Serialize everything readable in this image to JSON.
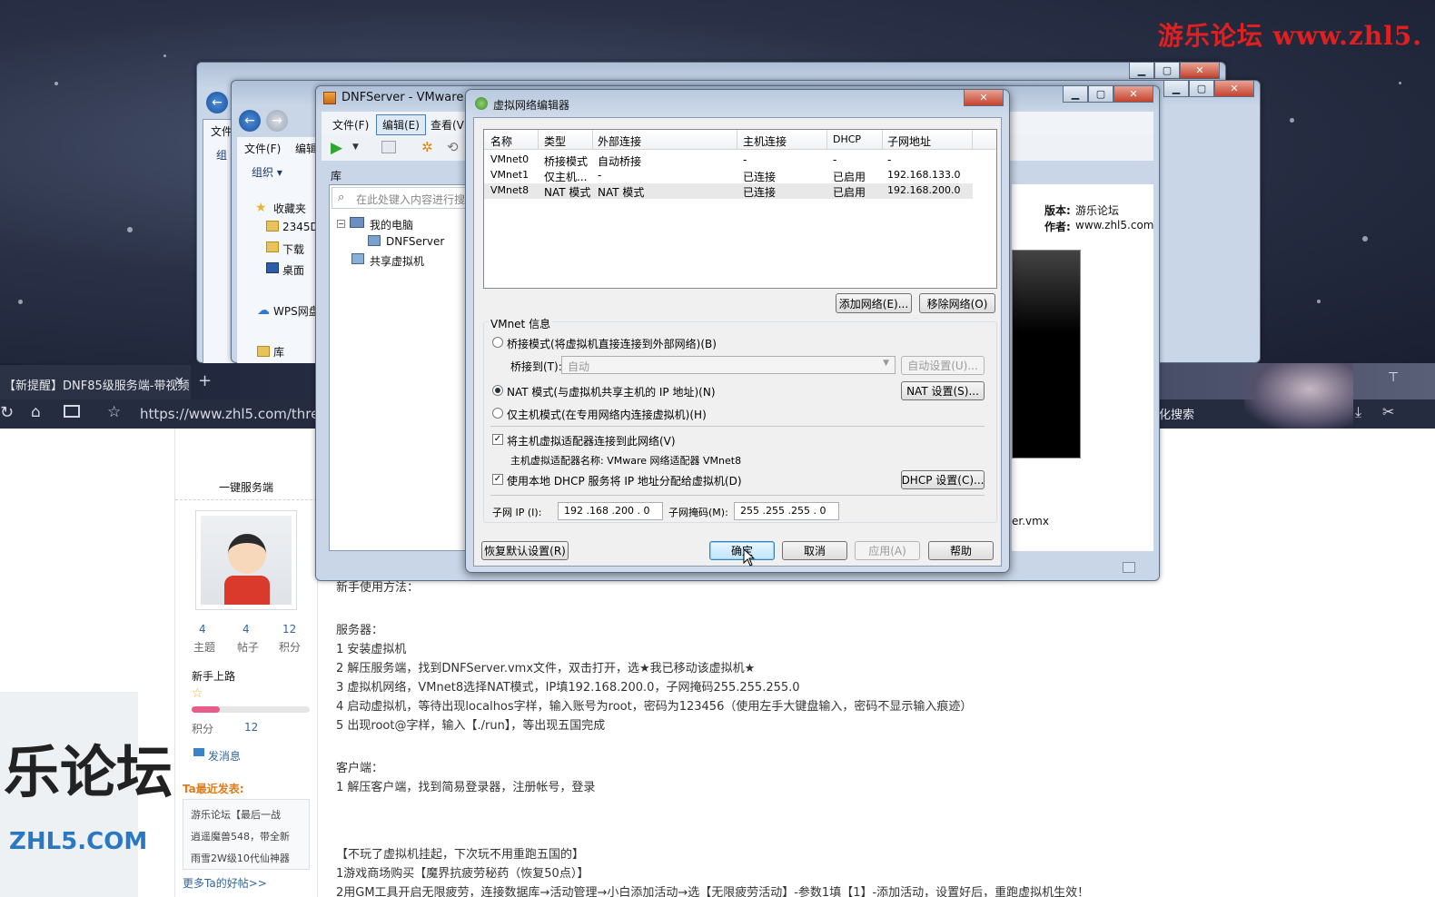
{
  "watermark_top": "游乐论坛 www.zhl5.",
  "explorer_back": {
    "menu_file": "文件",
    "menu_group": "组"
  },
  "explorer": {
    "menu_file": "文件(F)",
    "menu_edit": "编辑",
    "organize": "组织 ▾",
    "nav_items": [
      "收藏夹",
      "2345D",
      "下载",
      "桌面",
      "WPS网盘",
      "库"
    ]
  },
  "vmware": {
    "title": "DNFServer - VMware W",
    "menu_file": "文件(F)",
    "menu_edit": "编辑(E)",
    "menu_view": "查看(V)",
    "library_label": "库",
    "search_placeholder": "在此处键入内容进行搜",
    "tree_root": "我的电脑",
    "tree_vm": "DNFServer",
    "tree_shared": "共享虚拟机",
    "version_label": "版本:",
    "version_value": "游乐论坛",
    "author_label": "作者:",
    "author_value": "www.zhl5.com",
    "vmx_file": "er.vmx"
  },
  "browser": {
    "tab_title": "【新提醒】DNF85级服务端-带视频",
    "url": "https://www.zhl5.com/thread",
    "search_hint": "化搜索"
  },
  "forum": {
    "side_title": "一键服务端",
    "stats": [
      {
        "num": "4",
        "label": "主题"
      },
      {
        "num": "4",
        "label": "帖子"
      },
      {
        "num": "12",
        "label": "积分"
      }
    ],
    "rank": "新手上路",
    "score_label": "积分",
    "score_value": "12",
    "send_msg": "发消息",
    "recent_title": "Ta最近发表:",
    "recent_items": [
      "游乐论坛【最后一战",
      "逍遥魔兽548，带全新",
      "雨雪2W级10代仙神器"
    ],
    "more_posts": "更多Ta的好帖>>",
    "watermark_big": "乐论坛",
    "watermark_small": "ZHL5.COM",
    "post_lines": [
      "新手使用方法：",
      "服务器：",
      "1 安装虚拟机",
      "2 解压服务端，找到DNFServer.vmx文件，双击打开，选★我已移动该虚拟机★",
      "3 虚拟机网络，VMnet8选择NAT模式，IP填192.168.200.0，子网掩码255.255.255.0",
      "4 启动虚拟机，等待出现localhos字样，输入账号为root，密码为123456（使用左手大键盘输入，密码不显示输入痕迹）",
      "5 出现root@字样，输入【./run】，等出现五国完成",
      "客户端：",
      "1 解压客户端，找到简易登录器，注册帐号，登录",
      "【不玩了虚拟机挂起，下次玩不用重跑五国的】",
      "1游戏商场购买【魔界抗疲劳秘药（恢复50点）】",
      "2用GM工具开启无限疲劳，连接数据库→活动管理→小白添加活动→选【无限疲劳活动】-参数1填【1】-添加活动，设置好后，重跑虚拟机生效！"
    ]
  },
  "dialog": {
    "title": "虚拟网络编辑器",
    "columns": [
      "名称",
      "类型",
      "外部连接",
      "主机连接",
      "DHCP",
      "子网地址"
    ],
    "rows": [
      [
        "VMnet0",
        "桥接模式",
        "自动桥接",
        "-",
        "-",
        "-"
      ],
      [
        "VMnet1",
        "仅主机...",
        "-",
        "已连接",
        "已启用",
        "192.168.133.0"
      ],
      [
        "VMnet8",
        "NAT 模式",
        "NAT 模式",
        "已连接",
        "已启用",
        "192.168.200.0"
      ]
    ],
    "add_network": "添加网络(E)...",
    "remove_network": "移除网络(O)",
    "vmnet_info": "VMnet 信息",
    "bridge_mode": "桥接模式(将虚拟机直接连接到外部网络)(B)",
    "bridge_to": "桥接到(T):",
    "bridge_value": "自动",
    "auto_settings": "自动设置(U)...",
    "nat_mode": "NAT 模式(与虚拟机共享主机的 IP 地址)(N)",
    "nat_settings": "NAT 设置(S)...",
    "host_only": "仅主机模式(在专用网络内连接虚拟机)(H)",
    "connect_adapter": "将主机虚拟适配器连接到此网络(V)",
    "adapter_name": "主机虚拟适配器名称: VMware 网络适配器 VMnet8",
    "use_dhcp": "使用本地 DHCP 服务将 IP 地址分配给虚拟机(D)",
    "dhcp_settings": "DHCP 设置(C)...",
    "subnet_ip_label": "子网 IP (I):",
    "subnet_ip": "192 .168 .200 .  0",
    "subnet_mask_label": "子网掩码(M):",
    "subnet_mask": "255 .255 .255 .  0",
    "restore_defaults": "恢复默认设置(R)",
    "ok": "确定",
    "cancel": "取消",
    "apply": "应用(A)",
    "help": "帮助"
  }
}
